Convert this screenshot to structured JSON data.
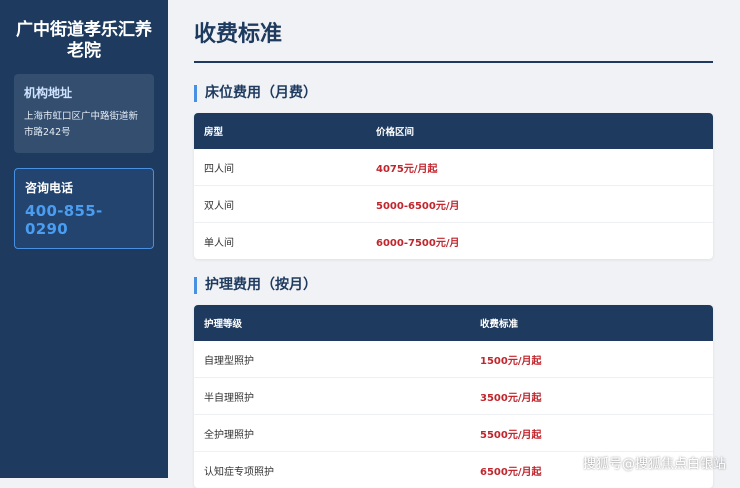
{
  "sidebar": {
    "org_name_line1": "广中街道孝乐汇养",
    "org_name_line2": "老院",
    "address_title": "机构地址",
    "address_line1": "上海市虹口区广中路街道新",
    "address_line2": "市路242号",
    "phone_title": "咨询电话",
    "phone_number": "400-855-0290"
  },
  "main": {
    "page_title": "收费标准",
    "bed_section": {
      "title": "床位费用（月费）",
      "headers": [
        "房型",
        "价格区间"
      ],
      "rows": [
        {
          "type": "四人间",
          "price": "4075元/月起"
        },
        {
          "type": "双人间",
          "price": "5000-6500元/月"
        },
        {
          "type": "单人间",
          "price": "6000-7500元/月"
        }
      ]
    },
    "care_section": {
      "title": "护理费用（按月）",
      "headers": [
        "护理等级",
        "收费标准"
      ],
      "rows": [
        {
          "level": "自理型照护",
          "price": "1500元/月起"
        },
        {
          "level": "半自理照护",
          "price": "3500元/月起"
        },
        {
          "level": "全护理照护",
          "price": "5500元/月起"
        },
        {
          "level": "认知症专项照护",
          "price": "6500元/月起"
        }
      ]
    }
  },
  "watermark": "搜狐号@搜狐焦点白银站",
  "colors": {
    "sidebar_bg": "#1e3a5f",
    "accent": "#4a90e2",
    "price": "#c0262d"
  }
}
